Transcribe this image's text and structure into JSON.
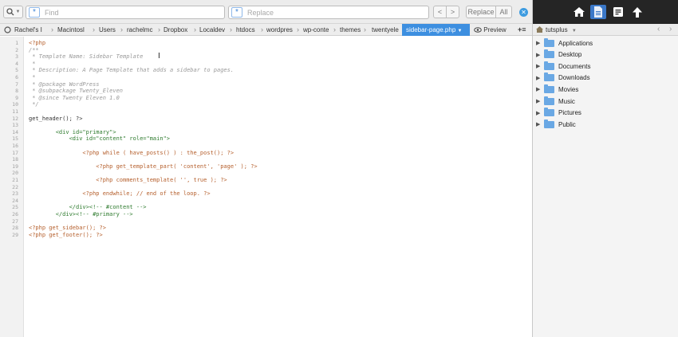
{
  "findbar": {
    "find_placeholder": "Find",
    "replace_placeholder": "Replace",
    "prev_label": "<",
    "next_label": ">",
    "replace_label": "Replace",
    "all_label": "All"
  },
  "pathbar": {
    "segments": [
      "Rachel's I",
      "Macintosl",
      "Users",
      "rachelmc",
      "Dropbox",
      "Localdev",
      "htdocs",
      "wordpres",
      "wp-conte",
      "themes",
      "twentyele"
    ],
    "active_file": "sidebar-page.php",
    "preview_label": "Preview"
  },
  "code": {
    "line_numbers": [
      "1",
      "2",
      "3",
      "4",
      "5",
      "6",
      "7",
      "8",
      "9",
      "10",
      "11",
      "12",
      "13",
      "14",
      "15",
      "16",
      "17",
      "18",
      "19",
      "20",
      "21",
      "22",
      "23",
      "24",
      "25",
      "26",
      "27",
      "28",
      "29"
    ],
    "lines": [
      "<?php",
      "/**",
      " * Template Name: Sidebar Template",
      " *",
      " * Description: A Page Template that adds a sidebar to pages.",
      " *",
      " * @package WordPress",
      " * @subpackage Twenty_Eleven",
      " * @since Twenty Eleven 1.0",
      " */",
      "",
      "get_header(); ?>",
      "",
      "        <div id=\"primary\">",
      "            <div id=\"content\" role=\"main\">",
      "",
      "                <?php while ( have_posts() ) : the_post(); ?>",
      "",
      "                    <?php get_template_part( 'content', 'page' ); ?>",
      "",
      "                    <?php comments_template( '', true ); ?>",
      "",
      "                <?php endwhile; // end of the loop. ?>",
      "",
      "            </div><!-- #content -->",
      "        </div><!-- #primary -->",
      "",
      "<?php get_sidebar(); ?>",
      "<?php get_footer(); ?>"
    ]
  },
  "browser": {
    "root_label": "tutsplus",
    "items": [
      {
        "label": "Applications"
      },
      {
        "label": "Desktop"
      },
      {
        "label": "Documents"
      },
      {
        "label": "Downloads"
      },
      {
        "label": "Movies"
      },
      {
        "label": "Music"
      },
      {
        "label": "Pictures"
      },
      {
        "label": "Public"
      }
    ]
  },
  "colors": {
    "accent": "#3d8fe0",
    "folder": "#6aa8e4",
    "topbar": "#252525"
  }
}
